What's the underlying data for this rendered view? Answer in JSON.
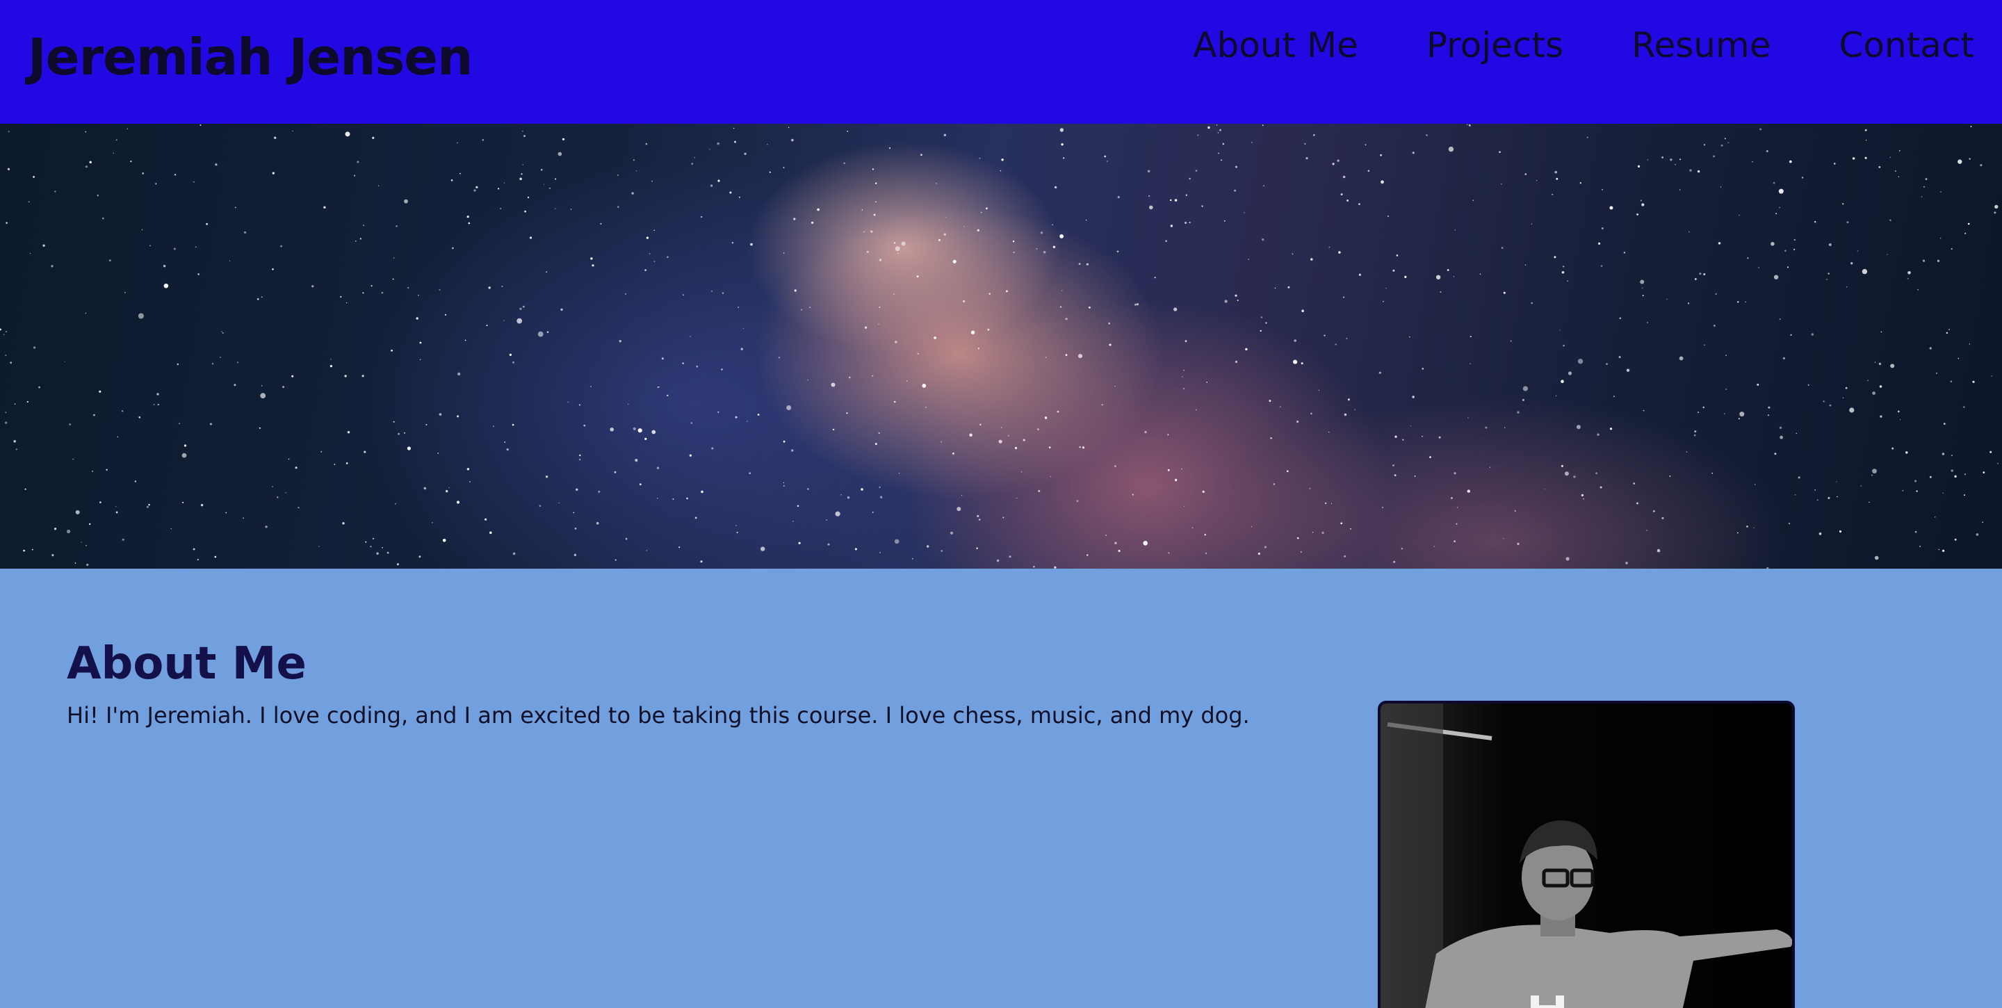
{
  "header": {
    "site_title": "Jeremiah Jensen",
    "nav": [
      {
        "label": "About Me"
      },
      {
        "label": "Projects"
      },
      {
        "label": "Resume"
      },
      {
        "label": "Contact"
      }
    ]
  },
  "about": {
    "heading": "About Me",
    "text": "Hi! I'm Jeremiah. I love coding, and I am excited to be taking this course. I love chess, music, and my dog."
  },
  "colors": {
    "header_bg": "#2209e3",
    "page_bg": "#72a0df",
    "title_text": "#0e0a2c"
  }
}
